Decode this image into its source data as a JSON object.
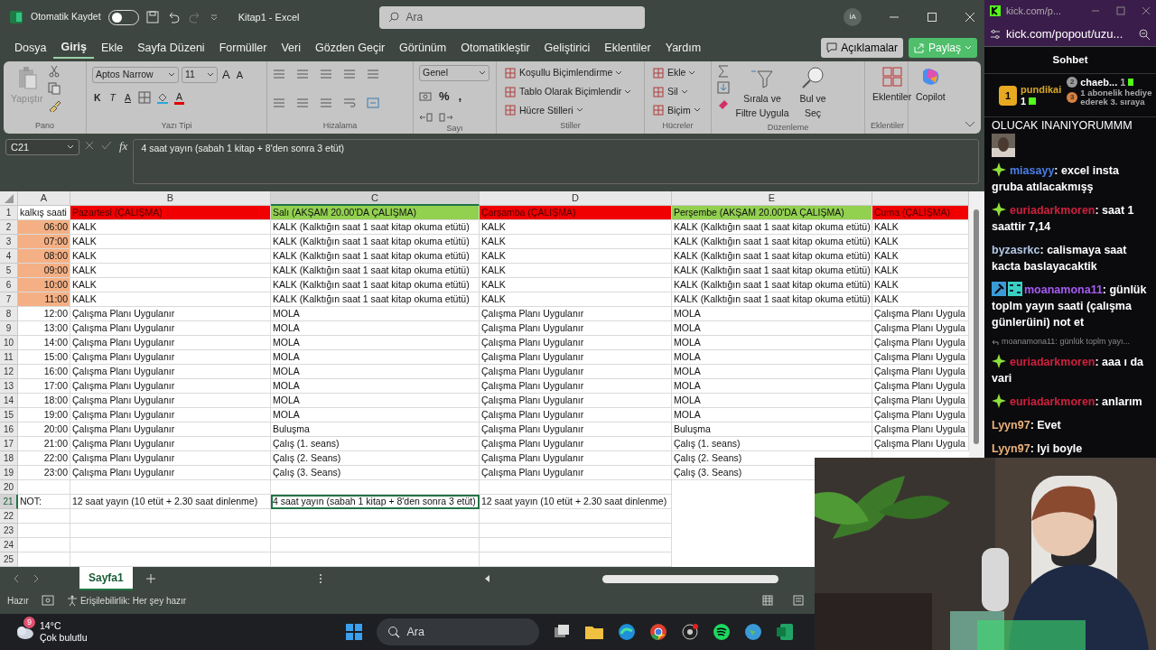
{
  "excel": {
    "title": "Kitap1 - Excel",
    "autosave": {
      "label": "Otomatik Kaydet",
      "on": false
    },
    "search": {
      "placeholder": "Ara"
    },
    "account": "İA",
    "menu": [
      {
        "label": "Dosya",
        "selected": false
      },
      {
        "label": "Giriş",
        "selected": true
      },
      {
        "label": "Ekle",
        "selected": false
      },
      {
        "label": "Sayfa Düzeni",
        "selected": false
      },
      {
        "label": "Formüller",
        "selected": false
      },
      {
        "label": "Veri",
        "selected": false
      },
      {
        "label": "Gözden Geçir",
        "selected": false
      },
      {
        "label": "Görünüm",
        "selected": false
      },
      {
        "label": "Otomatikleştir",
        "selected": false
      },
      {
        "label": "Geliştirici",
        "selected": false
      },
      {
        "label": "Eklentiler",
        "selected": false
      },
      {
        "label": "Yardım",
        "selected": false
      }
    ],
    "comments_button": "Açıklamalar",
    "share_button": "Paylaş",
    "ribbon": [
      {
        "kind": "clipboard",
        "label": "Pano",
        "paste": "Yapıştır",
        "paste_disabled": true
      },
      {
        "kind": "font",
        "label": "Yazı Tipi",
        "font": "Aptos Narrow",
        "size": "11",
        "size_buttons": [
          "A",
          "A"
        ],
        "buttons": [
          "K",
          "T",
          "A"
        ],
        "color_buttons": [
          "A"
        ]
      },
      {
        "kind": "alignment",
        "label": "Hizalama"
      },
      {
        "kind": "number",
        "label": "Sayı",
        "format": "Genel",
        "symbols": [
          "%",
          ","
        ]
      },
      {
        "kind": "list",
        "label": "Stiller",
        "items": [
          "Koşullu Biçimlendirme",
          "Tablo Olarak Biçimlendir",
          "Hücre Stilleri"
        ]
      },
      {
        "kind": "list",
        "label": "Hücreler",
        "items": [
          "Ekle",
          "Sil",
          "Biçim"
        ]
      },
      {
        "kind": "editing",
        "label": "Düzenleme",
        "items": [
          "Sırala ve Filtre Uygula",
          "Bul ve Seç"
        ]
      },
      {
        "kind": "addins",
        "label": "Eklentiler",
        "items": [
          "Eklentiler"
        ]
      },
      {
        "kind": "copilot",
        "items": [
          "Copilot"
        ]
      }
    ],
    "name_box": "C21",
    "fx": "fx",
    "formula": "4 saat yayın (sabah 1 kitap + 8'den sonra 3 etüt)",
    "columns": [
      {
        "label": "A",
        "selected": false
      },
      {
        "label": "B",
        "selected": false
      },
      {
        "label": "C",
        "selected": true
      },
      {
        "label": "D",
        "selected": false
      },
      {
        "label": "E",
        "selected": false
      },
      {
        "selected": false
      }
    ],
    "rows": [
      {
        "number": "1",
        "selected": false,
        "cells": [
          {
            "text": "kalkış saati"
          },
          {
            "text": "Pazartesi (ÇALIŞMA)",
            "color": "#f00000"
          },
          {
            "text": "Salı (AKŞAM 20.00'DA ÇALIŞMA)",
            "color": "#92d050"
          },
          {
            "text": "Çarşamba (ÇALIŞMA)",
            "color": "#f00000"
          },
          {
            "text": "Perşembe (AKŞAM 20.00'DA ÇALIŞMA)",
            "color": "#92d050"
          },
          {
            "text": "Cuma (ÇALIŞMA)",
            "color": "#f00000"
          }
        ]
      },
      {
        "number": "2",
        "selected": false,
        "cells": [
          {
            "text": "06:00",
            "kind": "time",
            "color": "#f4b084"
          },
          {
            "text": "KALK"
          },
          {
            "text": "KALK (Kalktığın saat 1 saat kitap okuma etütü)"
          },
          {
            "text": "KALK"
          },
          {
            "text": "KALK (Kalktığın saat 1 saat kitap okuma etütü)"
          },
          {
            "text": "KALK"
          }
        ]
      },
      {
        "number": "3",
        "selected": false,
        "cells": [
          {
            "text": "07:00",
            "kind": "time",
            "color": "#f4b084"
          },
          {
            "text": "KALK"
          },
          {
            "text": "KALK (Kalktığın saat 1 saat kitap okuma etütü)"
          },
          {
            "text": "KALK"
          },
          {
            "text": "KALK (Kalktığın saat 1 saat kitap okuma etütü)"
          },
          {
            "text": "KALK"
          }
        ]
      },
      {
        "number": "4",
        "selected": false,
        "cells": [
          {
            "text": "08:00",
            "kind": "time",
            "color": "#f4b084"
          },
          {
            "text": "KALK"
          },
          {
            "text": "KALK (Kalktığın saat 1 saat kitap okuma etütü)"
          },
          {
            "text": "KALK"
          },
          {
            "text": "KALK (Kalktığın saat 1 saat kitap okuma etütü)"
          },
          {
            "text": "KALK"
          }
        ]
      },
      {
        "number": "5",
        "selected": false,
        "cells": [
          {
            "text": "09:00",
            "kind": "time",
            "color": "#f4b084"
          },
          {
            "text": "KALK"
          },
          {
            "text": "KALK (Kalktığın saat 1 saat kitap okuma etütü)"
          },
          {
            "text": "KALK"
          },
          {
            "text": "KALK (Kalktığın saat 1 saat kitap okuma etütü)"
          },
          {
            "text": "KALK"
          }
        ]
      },
      {
        "number": "6",
        "selected": false,
        "cells": [
          {
            "text": "10:00",
            "kind": "time",
            "color": "#f4b084"
          },
          {
            "text": "KALK"
          },
          {
            "text": "KALK (Kalktığın saat 1 saat kitap okuma etütü)"
          },
          {
            "text": "KALK"
          },
          {
            "text": "KALK (Kalktığın saat 1 saat kitap okuma etütü)"
          },
          {
            "text": "KALK"
          }
        ]
      },
      {
        "number": "7",
        "selected": false,
        "cells": [
          {
            "text": "11:00",
            "kind": "time",
            "color": "#f4b084"
          },
          {
            "text": "KALK"
          },
          {
            "text": "KALK (Kalktığın saat 1 saat kitap okuma etütü)"
          },
          {
            "text": "KALK"
          },
          {
            "text": "KALK (Kalktığın saat 1 saat kitap okuma etütü)"
          },
          {
            "text": "KALK"
          }
        ]
      },
      {
        "number": "8",
        "selected": false,
        "cells": [
          {
            "text": "12:00",
            "kind": "time"
          },
          {
            "text": "Çalışma Planı Uygulanır"
          },
          {
            "text": "MOLA"
          },
          {
            "text": "Çalışma Planı Uygulanır"
          },
          {
            "text": "MOLA"
          },
          {
            "text": "Çalışma Planı Uygula"
          }
        ]
      },
      {
        "number": "9",
        "selected": false,
        "cells": [
          {
            "text": "13:00",
            "kind": "time"
          },
          {
            "text": "Çalışma Planı Uygulanır"
          },
          {
            "text": "MOLA"
          },
          {
            "text": "Çalışma Planı Uygulanır"
          },
          {
            "text": "MOLA"
          },
          {
            "text": "Çalışma Planı Uygula"
          }
        ]
      },
      {
        "number": "10",
        "selected": false,
        "cells": [
          {
            "text": "14:00",
            "kind": "time"
          },
          {
            "text": "Çalışma Planı Uygulanır"
          },
          {
            "text": "MOLA"
          },
          {
            "text": "Çalışma Planı Uygulanır"
          },
          {
            "text": "MOLA"
          },
          {
            "text": "Çalışma Planı Uygula"
          }
        ]
      },
      {
        "number": "11",
        "selected": false,
        "cells": [
          {
            "text": "15:00",
            "kind": "time"
          },
          {
            "text": "Çalışma Planı Uygulanır"
          },
          {
            "text": "MOLA"
          },
          {
            "text": "Çalışma Planı Uygulanır"
          },
          {
            "text": "MOLA"
          },
          {
            "text": "Çalışma Planı Uygula"
          }
        ]
      },
      {
        "number": "12",
        "selected": false,
        "cells": [
          {
            "text": "16:00",
            "kind": "time"
          },
          {
            "text": "Çalışma Planı Uygulanır"
          },
          {
            "text": "MOLA"
          },
          {
            "text": "Çalışma Planı Uygulanır"
          },
          {
            "text": "MOLA"
          },
          {
            "text": "Çalışma Planı Uygula"
          }
        ]
      },
      {
        "number": "13",
        "selected": false,
        "cells": [
          {
            "text": "17:00",
            "kind": "time"
          },
          {
            "text": "Çalışma Planı Uygulanır"
          },
          {
            "text": "MOLA"
          },
          {
            "text": "Çalışma Planı Uygulanır"
          },
          {
            "text": "MOLA"
          },
          {
            "text": "Çalışma Planı Uygula"
          }
        ]
      },
      {
        "number": "14",
        "selected": false,
        "cells": [
          {
            "text": "18:00",
            "kind": "time"
          },
          {
            "text": "Çalışma Planı Uygulanır"
          },
          {
            "text": "MOLA"
          },
          {
            "text": "Çalışma Planı Uygulanır"
          },
          {
            "text": "MOLA"
          },
          {
            "text": "Çalışma Planı Uygula"
          }
        ]
      },
      {
        "number": "15",
        "selected": false,
        "cells": [
          {
            "text": "19:00",
            "kind": "time"
          },
          {
            "text": "Çalışma Planı Uygulanır"
          },
          {
            "text": "MOLA"
          },
          {
            "text": "Çalışma Planı Uygulanır"
          },
          {
            "text": "MOLA"
          },
          {
            "text": "Çalışma Planı Uygula"
          }
        ]
      },
      {
        "number": "16",
        "selected": false,
        "cells": [
          {
            "text": "20:00",
            "kind": "time"
          },
          {
            "text": "Çalışma Planı Uygulanır"
          },
          {
            "text": "Buluşma"
          },
          {
            "text": "Çalışma Planı Uygulanır"
          },
          {
            "text": "Buluşma"
          },
          {
            "text": "Çalışma Planı Uygula"
          }
        ]
      },
      {
        "number": "17",
        "selected": false,
        "cells": [
          {
            "text": "21:00",
            "kind": "time"
          },
          {
            "text": "Çalışma Planı Uygulanır"
          },
          {
            "text": "Çalış (1. seans)"
          },
          {
            "text": "Çalışma Planı Uygulanır"
          },
          {
            "text": "Çalış (1. seans)"
          },
          {
            "text": "Çalışma Planı Uygula"
          }
        ]
      },
      {
        "number": "18",
        "selected": false,
        "cells": [
          {
            "text": "22:00",
            "kind": "time"
          },
          {
            "text": "Çalışma Planı Uygulanır"
          },
          {
            "text": "Çalış (2. Seans)"
          },
          {
            "text": "Çalışma Planı Uygulanır"
          },
          {
            "text": "Çalış (2. Seans)"
          }
        ]
      },
      {
        "number": "19",
        "selected": false,
        "cells": [
          {
            "text": "23:00",
            "kind": "time"
          },
          {
            "text": "Çalışma Planı Uygulanır"
          },
          {
            "text": "Çalış (3. Seans)"
          },
          {
            "text": "Çalışma Planı Uygulanır"
          },
          {
            "text": "Çalış (3. Seans)"
          }
        ]
      },
      {
        "number": "20",
        "selected": false,
        "cells": []
      },
      {
        "number": "21",
        "selected": true,
        "cells": [
          {
            "text": "NOT:"
          },
          {
            "text": "12 saat yayın (10 etüt + 2.30 saat dinlenme)"
          },
          {
            "text": "4 saat yayın (sabah 1 kitap + 8'den sonra 3 etüt)"
          },
          {
            "text": "12 saat yayın (10 etüt + 2.30 saat dinlenme)"
          }
        ]
      },
      {
        "number": "22",
        "selected": false,
        "cells": []
      },
      {
        "number": "23",
        "selected": false,
        "cells": []
      },
      {
        "number": "24",
        "selected": false,
        "cells": []
      },
      {
        "number": "25",
        "selected": false,
        "cells": []
      }
    ],
    "sheet_tabs": [
      {
        "label": "Sayfa1",
        "selected": true
      }
    ],
    "status": "Hazır",
    "accessibility": "Erişilebilirlik: Her şey hazır"
  },
  "chat": {
    "tab_title": "kick.com/p...",
    "address": "kick.com/popout/uzu...",
    "heading": "Sohbet",
    "leaders": [
      {
        "rank": "1",
        "user": "pundikai",
        "count": "1"
      },
      {
        "rank": "2",
        "user": "chaeb...",
        "count": "1"
      }
    ],
    "promo": {
      "rank": "3",
      "text": "1 abonelik hediye ederek 3. sıraya"
    },
    "messages": [
      {
        "kind": "fragment",
        "text": "OLUCAK INANIYORUMMM"
      },
      {
        "kind": "emote"
      },
      {
        "kind": "sparkle",
        "user": "miasayy",
        "color": "#4a7fe8",
        "text": ": excel insta gruba atılacakmışş"
      },
      {
        "kind": "sparkle",
        "user": "euriadarkmoren",
        "color": "#d0203c",
        "text": ": saat 1 saattir 7,14"
      },
      {
        "kind": "plain",
        "user": "byzasrkc",
        "color": "#b4c8e6",
        "text": ": calismaya saat kacta baslayacaktik"
      },
      {
        "kind": "tools",
        "user": "moanamona11",
        "color": "#a65cf4",
        "text": ": günlük toplm yayın saati (çalışma günlerüini) not et"
      },
      {
        "kind": "reply",
        "text": "moanamona11: günlük toplm yayı..."
      },
      {
        "kind": "sparkle",
        "user": "euriadarkmoren",
        "color": "#d0203c",
        "text": ": aaa ı da vari"
      },
      {
        "kind": "sparkle",
        "user": "euriadarkmoren",
        "color": "#d0203c",
        "text": ": anlarım"
      },
      {
        "kind": "plain",
        "user": "Lyyn97",
        "color": "#eab27a",
        "text": ": Evet"
      },
      {
        "kind": "plain",
        "user": "Lyyn97",
        "color": "#eab27a",
        "text": ": Iyi boyle"
      }
    ]
  },
  "taskbar": {
    "weather_badge": "9",
    "temperature": "14°C",
    "weather": "Çok bulutlu",
    "search": {
      "placeholder": "Ara"
    }
  }
}
